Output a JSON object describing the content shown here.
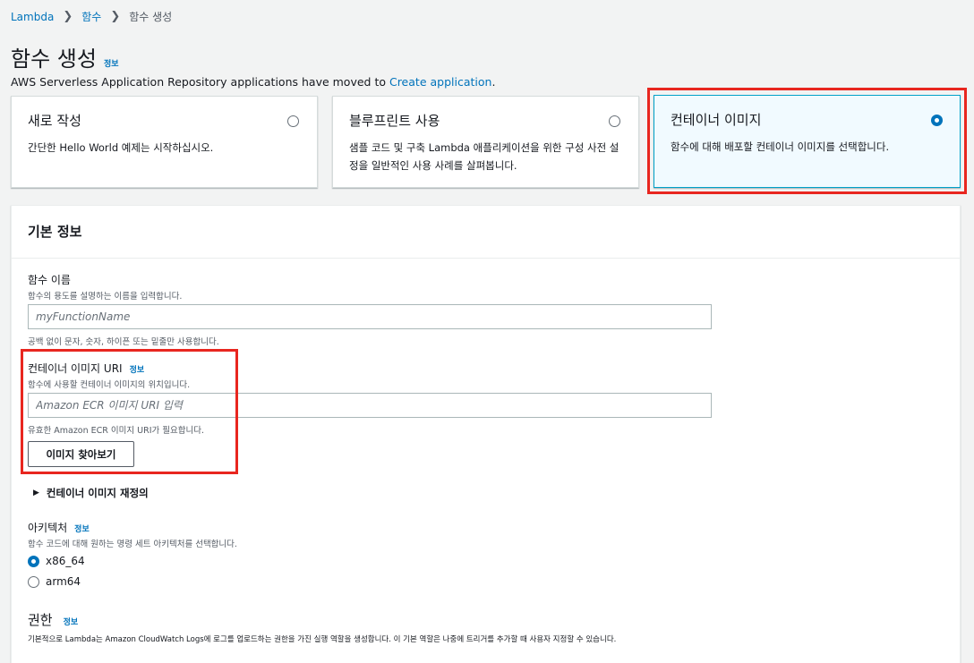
{
  "breadcrumb": {
    "items": [
      "Lambda",
      "함수"
    ],
    "current": "함수 생성"
  },
  "page": {
    "title": "함수 생성",
    "info": "정보",
    "moved_note": "AWS Serverless Application Repository applications have moved to ",
    "moved_link": "Create application",
    "moved_suffix": "."
  },
  "options": [
    {
      "title": "새로 작성",
      "desc": "간단한 Hello World 예제는 시작하십시오.",
      "selected": false
    },
    {
      "title": "블루프린트 사용",
      "desc": "샘플 코드 및 구축 Lambda 애플리케이션을 위한 구성 사전 설정을 일반적인 사용 사례를 살펴봅니다.",
      "selected": false
    },
    {
      "title": "컨테이너 이미지",
      "desc": "함수에 대해 배포할 컨테이너 이미지를 선택합니다.",
      "selected": true
    }
  ],
  "basic": {
    "header": "기본 정보",
    "function_name": {
      "label": "함수 이름",
      "desc": "함수의 용도를 설명하는 이름을 입력합니다.",
      "placeholder": "myFunctionName",
      "hint": "공백 없이 문자, 숫자, 하이픈 또는 밑줄만 사용합니다."
    },
    "image_uri": {
      "label": "컨테이너 이미지 URI",
      "info": "정보",
      "desc": "함수에 사용할 컨테이너 이미지의 위치입니다.",
      "placeholder": "Amazon ECR 이미지 URI 입력",
      "hint": "유효한 Amazon ECR 이미지 URI가 필요합니다.",
      "browse_button": "이미지 찾아보기"
    },
    "override": "컨테이너 이미지 재정의",
    "architecture": {
      "label": "아키텍처",
      "info": "정보",
      "desc": "함수 코드에 대해 원하는 명령 세트 아키텍처를 선택합니다.",
      "options": [
        {
          "label": "x86_64",
          "selected": true
        },
        {
          "label": "arm64",
          "selected": false
        }
      ]
    },
    "permissions": {
      "title": "권한",
      "info": "정보",
      "desc": "기본적으로 Lambda는 Amazon CloudWatch Logs에 로그를 업로드하는 권한을 가진 실행 역할을 생성합니다. 이 기본 역할은 나중에 트리거를 추가할 때 사용자 지정할 수 있습니다."
    }
  },
  "colors": {
    "link": "#0073bb",
    "highlight": "#e8261f",
    "selected_card_bg": "#f1faff"
  }
}
